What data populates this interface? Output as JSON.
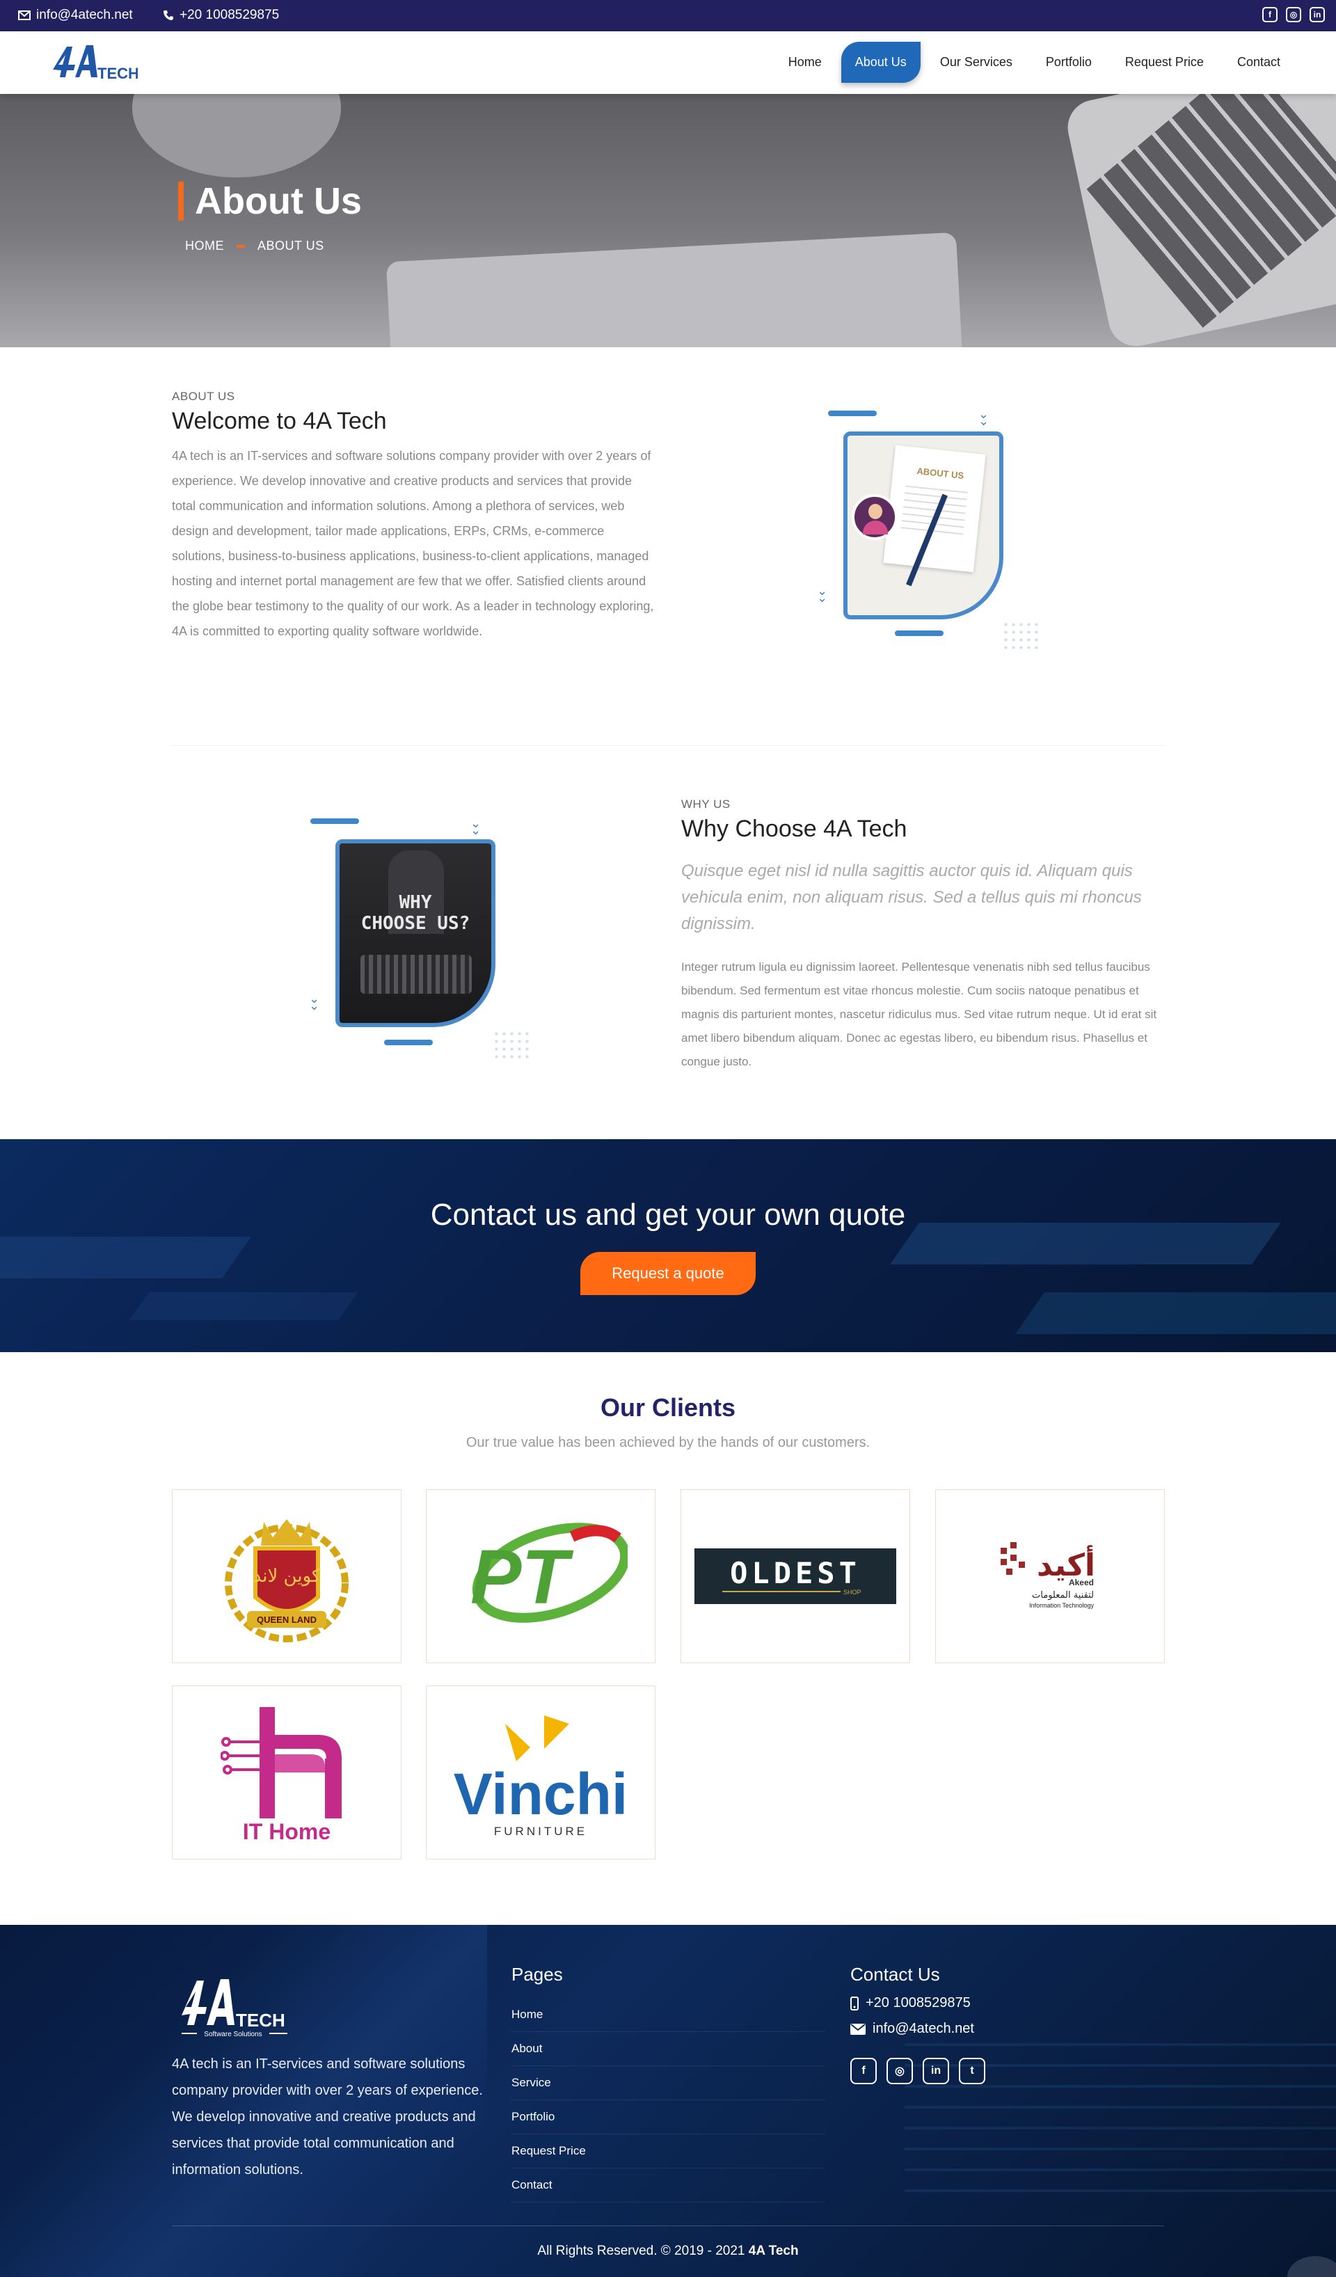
{
  "topbar": {
    "email": "info@4atech.net",
    "phone": "+20 1008529875",
    "social": [
      "facebook-icon",
      "instagram-icon",
      "linkedin-icon"
    ]
  },
  "nav": {
    "logo_text": "4A",
    "logo_sub": "TECH",
    "items": [
      {
        "label": "Home"
      },
      {
        "label": "About Us"
      },
      {
        "label": "Our Services"
      },
      {
        "label": "Portfolio"
      },
      {
        "label": "Request Price"
      },
      {
        "label": "Contact"
      }
    ],
    "active_index": 1
  },
  "hero": {
    "title": "About Us",
    "crumb_home": "HOME",
    "crumb_current": "ABOUT US"
  },
  "about": {
    "eyebrow": "ABOUT US",
    "title": "Welcome to 4A Tech",
    "body": "4A tech is an IT-services and software solutions company provider with over 2 years of experience. We develop innovative and creative products and services that provide total communication and information solutions. Among a plethora of services, web design and development, tailor made applications, ERPs, CRMs, e-commerce solutions, business-to-business applications, business-to-client applications, managed hosting and internet portal management are few that we offer. Satisfied clients around the globe bear testimony to the quality of our work. As a leader in technology exploring, 4A is committed to exporting quality software worldwide.",
    "image_label": "ABOUT US"
  },
  "why": {
    "eyebrow": "WHY US",
    "title": "Why Choose 4A Tech",
    "lead": "Quisque eget nisl id nulla sagittis auctor quis id. Aliquam quis vehicula enim, non aliquam risus. Sed a tellus quis mi rhoncus dignissim.",
    "body": "Integer rutrum ligula eu dignissim laoreet. Pellentesque venenatis nibh sed tellus faucibus bibendum. Sed fermentum est vitae rhoncus molestie. Cum sociis natoque penatibus et magnis dis parturient montes, nascetur ridiculus mus. Sed vitae rutrum neque. Ut id erat sit amet libero bibendum aliquam. Donec ac egestas libero, eu bibendum risus. Phasellus et congue justo.",
    "image_line1": "WHY",
    "image_line2": "CHOOSE US?"
  },
  "cta": {
    "title": "Contact us and get your own quote",
    "button": "Request a quote"
  },
  "clients": {
    "title": "Our Clients",
    "subtitle": "Our true value has been achieved by the hands of our customers.",
    "logos": [
      {
        "name": "QUEEN LAND",
        "arabic": "كوين لاند"
      },
      {
        "name": "PT"
      },
      {
        "name": "OLDEST",
        "sub": "SHOP"
      },
      {
        "name": "Akeed",
        "arabic": "أكيد",
        "sub": "Information Technology",
        "arabic_sub": "لتقنية المعلومات"
      },
      {
        "name": "IT Home"
      },
      {
        "name": "Vinchi",
        "sub": "FURNITURE"
      }
    ]
  },
  "footer": {
    "logo_text": "4A",
    "logo_sub": "TECH",
    "logo_tag": "Software Solutions",
    "about": "4A tech is an IT-services and software solutions company provider with over 2 years of experience. We develop innovative and creative products and services that provide total communication and information solutions.",
    "pages_title": "Pages",
    "pages": [
      "Home",
      "About",
      "Service",
      "Portfolio",
      "Request Price",
      "Contact"
    ],
    "contact_title": "Contact Us",
    "phone": "+20 1008529875",
    "email": "info@4atech.net",
    "social": [
      "facebook-icon",
      "instagram-icon",
      "linkedin-icon",
      "twitter-icon"
    ],
    "copyright": "All Rights Reserved. © 2019 - 2021",
    "brand": "4A Tech"
  },
  "colors": {
    "topbar": "#22205f",
    "nav_active": "#1f69b8",
    "accent_orange": "#ff6a13",
    "clients_title": "#23236a"
  }
}
